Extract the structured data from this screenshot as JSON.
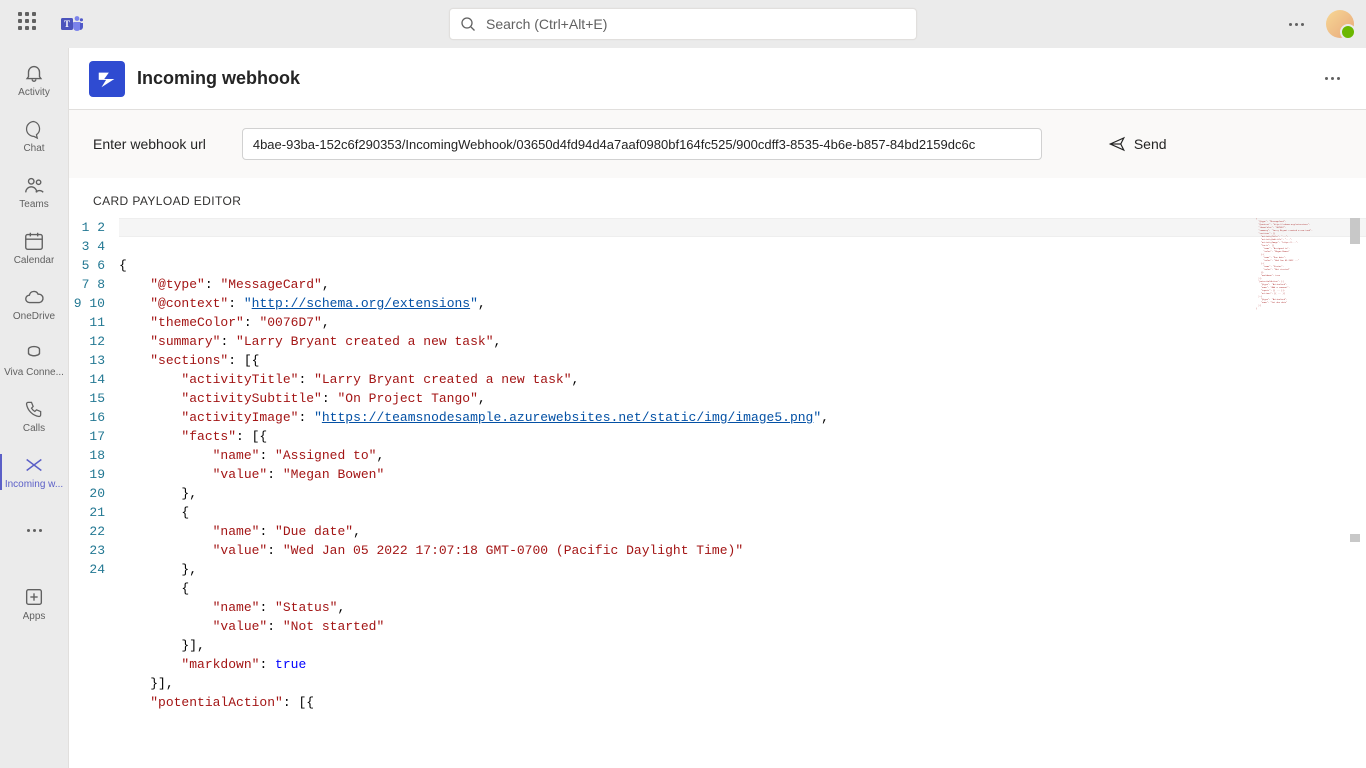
{
  "topbar": {
    "search_placeholder": "Search (Ctrl+Alt+E)"
  },
  "rail": {
    "items": [
      {
        "id": "activity",
        "label": "Activity"
      },
      {
        "id": "chat",
        "label": "Chat"
      },
      {
        "id": "teams",
        "label": "Teams"
      },
      {
        "id": "calendar",
        "label": "Calendar"
      },
      {
        "id": "onedrive",
        "label": "OneDrive"
      },
      {
        "id": "viva",
        "label": "Viva Conne..."
      },
      {
        "id": "calls",
        "label": "Calls"
      },
      {
        "id": "incoming",
        "label": "Incoming w..."
      }
    ],
    "apps_label": "Apps"
  },
  "page": {
    "title": "Incoming webhook"
  },
  "urlrow": {
    "label": "Enter webhook url",
    "value": "4bae-93ba-152c6f290353/IncomingWebhook/03650d4fd94d4a7aaf0980bf164fc525/900cdff3-8535-4b6e-b857-84bd2159dc6c",
    "send": "Send"
  },
  "editor": {
    "label": "CARD PAYLOAD EDITOR",
    "line_numbers": [
      "1",
      "2",
      "3",
      "4",
      "5",
      "6",
      "7",
      "8",
      "9",
      "10",
      "11",
      "12",
      "13",
      "14",
      "15",
      "16",
      "17",
      "18",
      "19",
      "20",
      "21",
      "22",
      "23",
      "24"
    ],
    "v": {
      "type": "\"@type\"",
      "type_v": "\"MessageCard\"",
      "ctx": "\"@context\"",
      "ctx_v": "http://schema.org/extensions",
      "theme": "\"themeColor\"",
      "theme_v": "\"0076D7\"",
      "summary": "\"summary\"",
      "summary_v": "\"Larry Bryant created a new task\"",
      "sections": "\"sections\"",
      "at": "\"activityTitle\"",
      "at_v": "\"Larry Bryant created a new task\"",
      "as": "\"activitySubtitle\"",
      "as_v": "\"On Project Tango\"",
      "ai": "\"activityImage\"",
      "ai_v": "https://teamsnodesample.azurewebsites.net/static/img/image5.png",
      "facts": "\"facts\"",
      "name": "\"name\"",
      "value": "\"value\"",
      "f1n": "\"Assigned to\"",
      "f1v": "\"Megan Bowen\"",
      "f2n": "\"Due date\"",
      "f2v": "\"Wed Jan 05 2022 17:07:18 GMT-0700 (Pacific Daylight Time)\"",
      "f3n": "\"Status\"",
      "f3v": "\"Not started\"",
      "markdown": "\"markdown\"",
      "true": "true",
      "pa": "\"potentialAction\""
    }
  }
}
